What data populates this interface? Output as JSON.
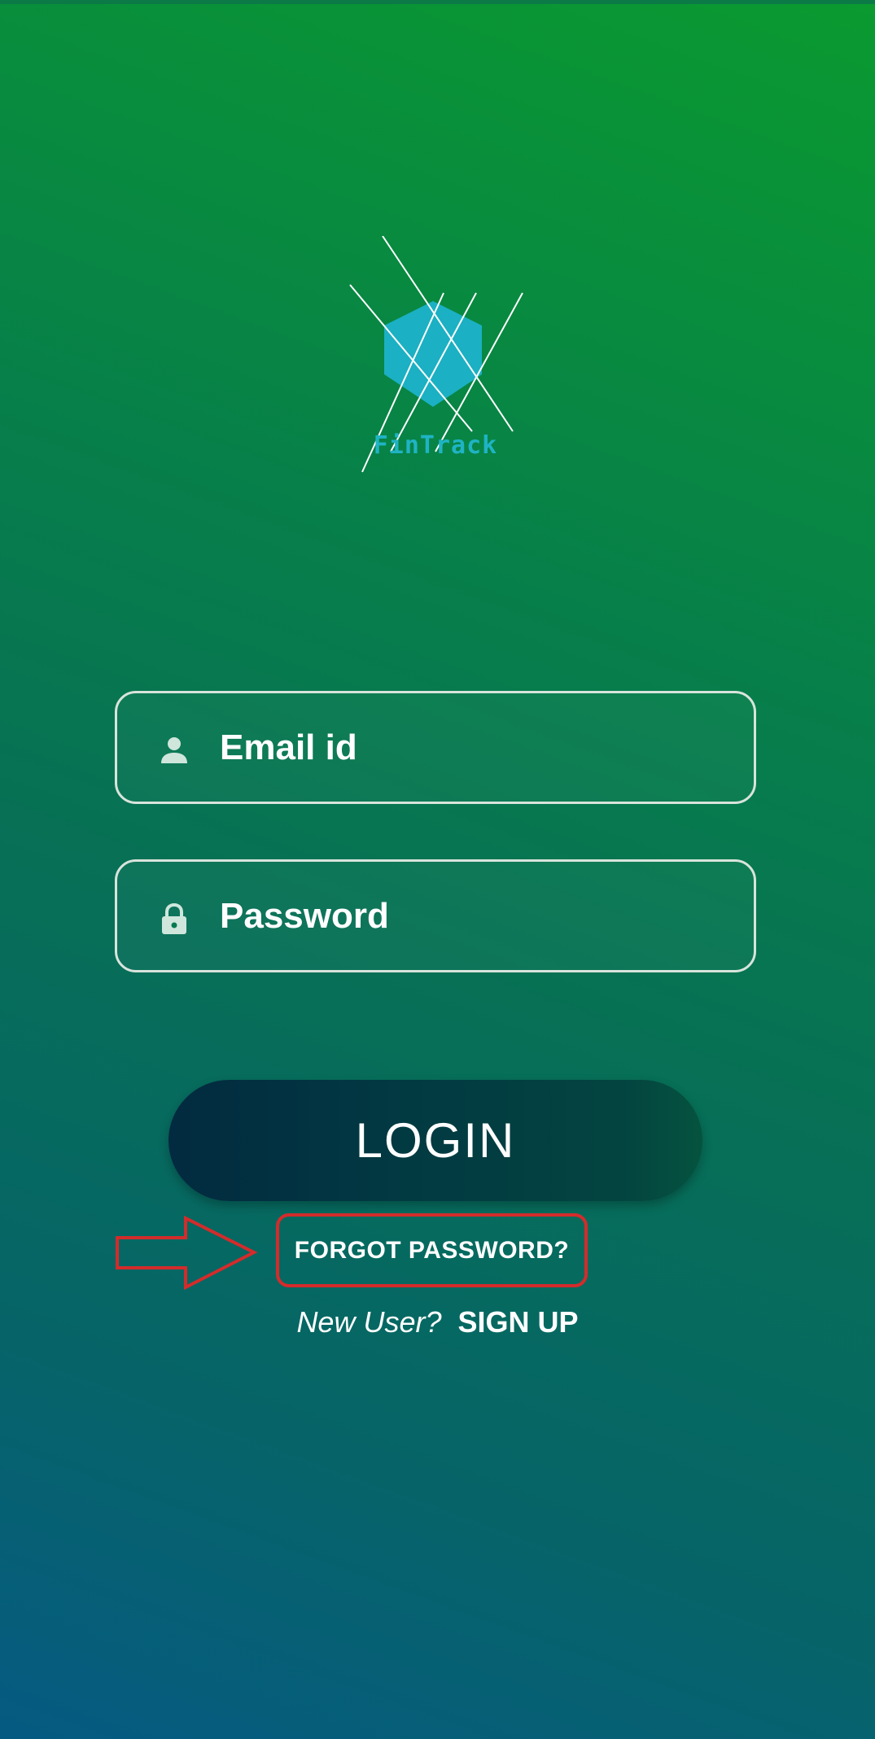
{
  "app": {
    "logo_text": "FinTrack",
    "logo_icon": "hexagon-logo-icon"
  },
  "form": {
    "email": {
      "icon": "person-icon",
      "placeholder": "Email id",
      "value": ""
    },
    "password": {
      "icon": "lock-icon",
      "placeholder": "Password",
      "value": ""
    },
    "login_label": "LOGIN",
    "forgot_label": "FORGOT PASSWORD?",
    "new_user_label": "New User?",
    "signup_label": "SIGN UP"
  },
  "annotation": {
    "highlight_color": "#d42b2b",
    "arrow_icon": "right-arrow-outline-icon"
  },
  "colors": {
    "gradient_top": "#0a9a30",
    "gradient_bottom": "#055a82",
    "button": "#023a42",
    "logo_accent": "#1fb3c4"
  }
}
